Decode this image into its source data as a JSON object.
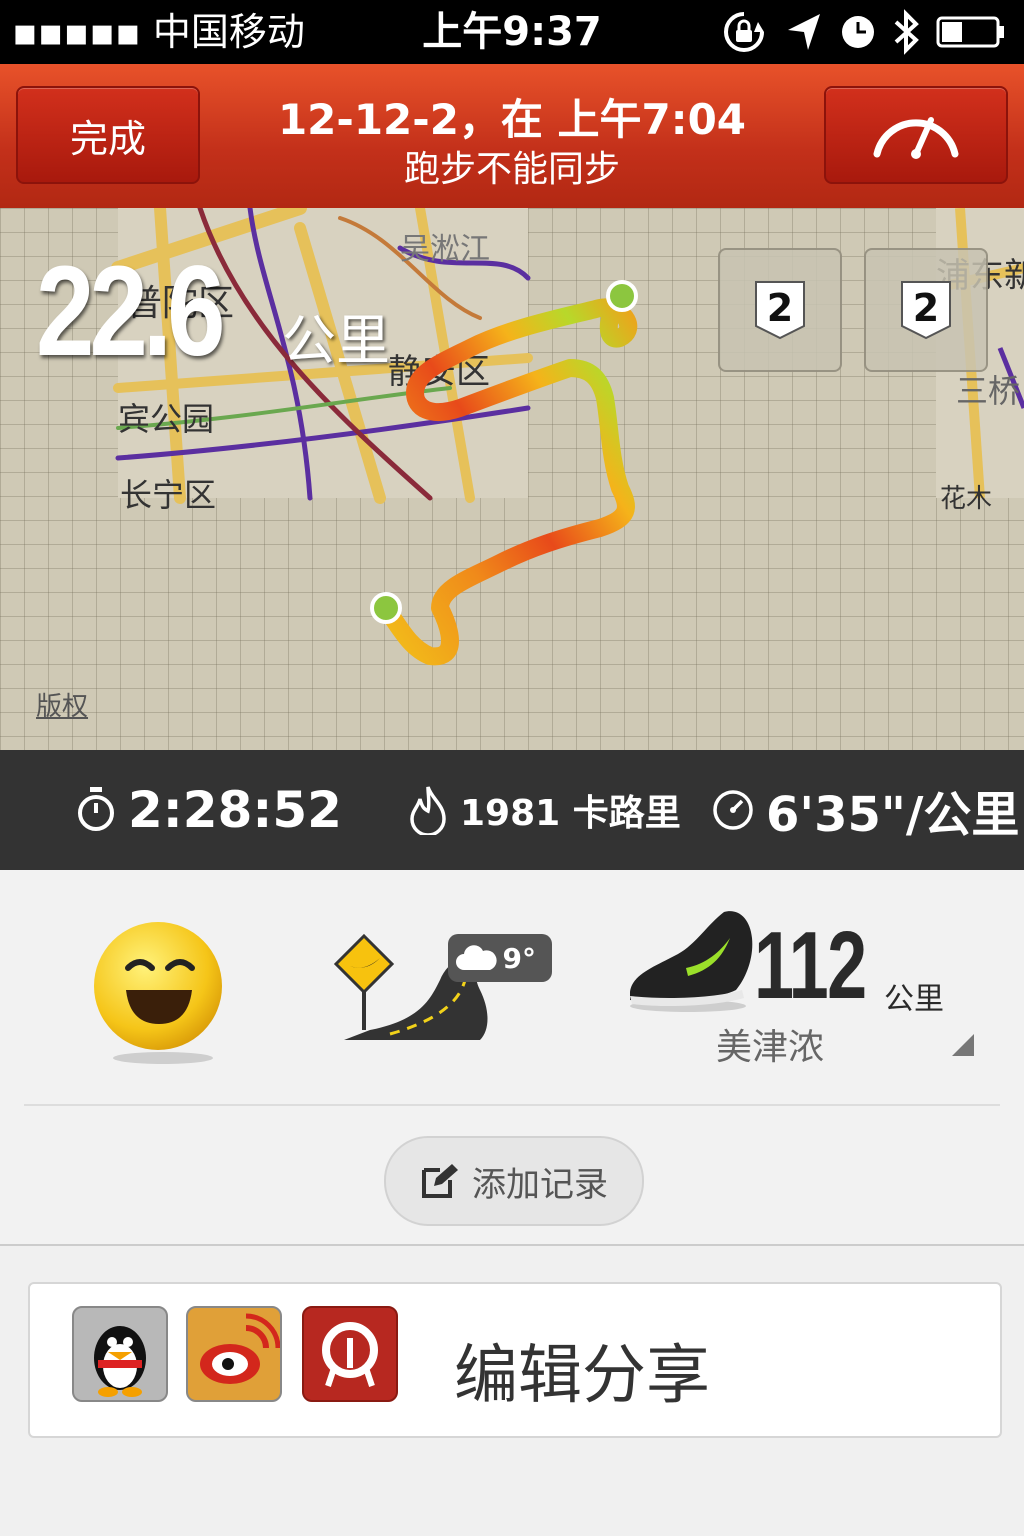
{
  "status_bar": {
    "carrier": "▪▪▪▪▪ 中国移动",
    "time": "上午9:37"
  },
  "header": {
    "done_label": "完成",
    "title": "12-12-2，在 上午7:04",
    "subtitle": "跑步不能同步"
  },
  "map": {
    "distance": "22.6",
    "distance_unit": "公里",
    "labels": [
      "吴淞江",
      "普陀区",
      "静安区",
      "宾公园",
      "长宁区",
      "浦东新",
      "三桥",
      "花木"
    ],
    "mile_markers": [
      "2",
      "2"
    ],
    "copyright": "版权"
  },
  "stats": {
    "duration": "2:28:52",
    "calories": "1981 卡路里",
    "pace": "6'35\"/公里"
  },
  "run_details": {
    "temperature": "9°",
    "shoe_distance": "112",
    "shoe_unit": "公里",
    "shoe_name": "美津浓"
  },
  "add_record_label": "添加记录",
  "share": {
    "label": "编辑分享"
  }
}
